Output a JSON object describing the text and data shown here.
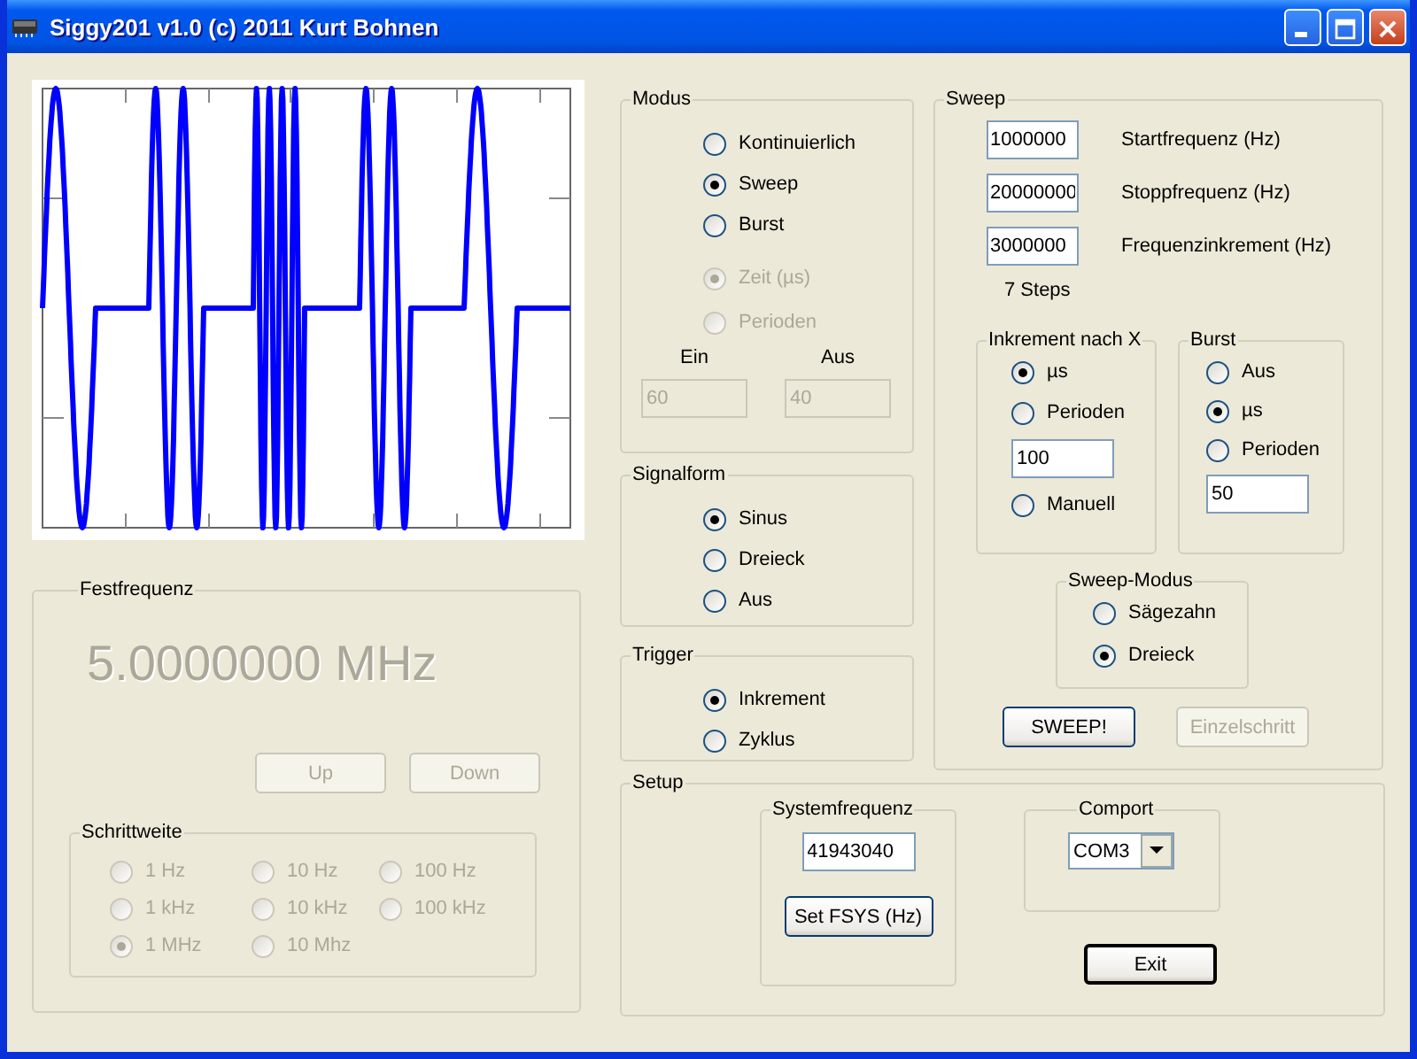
{
  "window": {
    "title": "Siggy201 v1.0 (c) 2011 Kurt Bohnen"
  },
  "festfrequenz": {
    "title": "Festfrequenz",
    "frequency": "5.0000000 MHz",
    "disabled": true,
    "buttons": [
      {
        "label": "Up",
        "disabled": true
      },
      {
        "label": "Down",
        "disabled": true
      }
    ],
    "schrittweite": {
      "title": "Schrittweite",
      "options": [
        {
          "label": "1 Hz",
          "selected": false,
          "disabled": true
        },
        {
          "label": "10 Hz",
          "selected": false,
          "disabled": true
        },
        {
          "label": "100 Hz",
          "selected": false,
          "disabled": true
        },
        {
          "label": "1 kHz",
          "selected": false,
          "disabled": true
        },
        {
          "label": "10 kHz",
          "selected": false,
          "disabled": true
        },
        {
          "label": "100 kHz",
          "selected": false,
          "disabled": true
        },
        {
          "label": "1 MHz",
          "selected": true,
          "disabled": true
        },
        {
          "label": "10 Mhz",
          "selected": false,
          "disabled": true
        }
      ]
    }
  },
  "modus": {
    "title": "Modus",
    "options": [
      {
        "label": "Kontinuierlich",
        "selected": false,
        "disabled": false
      },
      {
        "label": "Sweep",
        "selected": true,
        "disabled": false
      },
      {
        "label": "Burst",
        "selected": false,
        "disabled": false
      }
    ],
    "burst_options": [
      {
        "label": "Zeit (µs)",
        "selected": true,
        "disabled": true
      },
      {
        "label": "Perioden",
        "selected": false,
        "disabled": true
      }
    ],
    "fields": [
      {
        "label": "Ein",
        "value": "60",
        "disabled": true
      },
      {
        "label": "Aus",
        "value": "40",
        "disabled": true
      }
    ]
  },
  "signalform": {
    "title": "Signalform",
    "options": [
      {
        "label": "Sinus",
        "selected": true
      },
      {
        "label": "Dreieck",
        "selected": false
      },
      {
        "label": "Aus",
        "selected": false
      }
    ]
  },
  "trigger": {
    "title": "Trigger",
    "options": [
      {
        "label": "Inkrement",
        "selected": true
      },
      {
        "label": "Zyklus",
        "selected": false
      }
    ]
  },
  "sweep": {
    "title": "Sweep",
    "fields": [
      {
        "value": "1000000",
        "label": "Startfrequenz (Hz)"
      },
      {
        "value": "20000000",
        "label": "Stoppfrequenz (Hz)"
      },
      {
        "value": "3000000",
        "label": "Frequenzinkrement (Hz)"
      }
    ],
    "steps": "7 Steps",
    "inkrement": {
      "title": "Inkrement nach X",
      "items": [
        {
          "kind": "radio",
          "label": "µs",
          "selected": true
        },
        {
          "kind": "radio",
          "label": "Perioden",
          "selected": false
        },
        {
          "kind": "field",
          "value": "100"
        },
        {
          "kind": "radio",
          "label": "Manuell",
          "selected": false
        }
      ]
    },
    "burst": {
      "title": "Burst",
      "items": [
        {
          "kind": "radio",
          "label": "Aus",
          "selected": false
        },
        {
          "kind": "radio",
          "label": "µs",
          "selected": true
        },
        {
          "kind": "radio",
          "label": "Perioden",
          "selected": false
        },
        {
          "kind": "field",
          "value": "50"
        }
      ]
    },
    "sweep_modus": {
      "title": "Sweep-Modus",
      "options": [
        {
          "label": "Sägezahn",
          "selected": false
        },
        {
          "label": "Dreieck",
          "selected": true
        }
      ]
    },
    "buttons": [
      {
        "label": "SWEEP!",
        "disabled": false
      },
      {
        "label": "Einzelschritt",
        "disabled": true
      }
    ]
  },
  "setup": {
    "title": "Setup",
    "systemfrequenz": {
      "title": "Systemfrequenz",
      "value": "41943040",
      "button": "Set FSYS (Hz)"
    },
    "comport": {
      "title": "Comport",
      "value": "COM3"
    },
    "exit": "Exit"
  }
}
